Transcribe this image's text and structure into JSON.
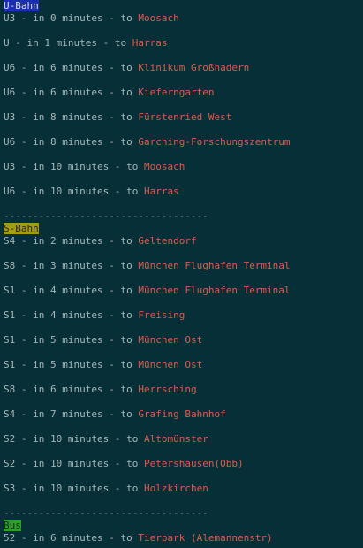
{
  "sections": [
    {
      "header": "U-Bahn",
      "rows": [
        {
          "line": "U3",
          "minutes": "0",
          "dest": "Moosach"
        },
        {
          "line": "U",
          "minutes": "1",
          "dest": "Harras"
        },
        {
          "line": "U6",
          "minutes": "6",
          "dest": "Klinikum Großhadern"
        },
        {
          "line": "U6",
          "minutes": "6",
          "dest": "Kieferngarten"
        },
        {
          "line": "U3",
          "minutes": "8",
          "dest": "Fürstenried West"
        },
        {
          "line": "U6",
          "minutes": "8",
          "dest": "Garching-Forschungszentrum"
        },
        {
          "line": "U3",
          "minutes": "10",
          "dest": "Moosach"
        },
        {
          "line": "U6",
          "minutes": "10",
          "dest": "Harras"
        }
      ]
    },
    {
      "header": "S-Bahn",
      "rows": [
        {
          "line": "S4",
          "minutes": "2",
          "dest": "Geltendorf"
        },
        {
          "line": "S8",
          "minutes": "3",
          "dest": "München Flughafen Terminal"
        },
        {
          "line": "S1",
          "minutes": "4",
          "dest": "München Flughafen Terminal"
        },
        {
          "line": "S1",
          "minutes": "4",
          "dest": "Freising"
        },
        {
          "line": "S1",
          "minutes": "5",
          "dest": "München Ost"
        },
        {
          "line": "S1",
          "minutes": "5",
          "dest": "München Ost"
        },
        {
          "line": "S8",
          "minutes": "6",
          "dest": "Herrsching"
        },
        {
          "line": "S4",
          "minutes": "7",
          "dest": "Grafing Bahnhof"
        },
        {
          "line": "S2",
          "minutes": "10",
          "dest": "Altomünster"
        },
        {
          "line": "S2",
          "minutes": "10",
          "dest": "Petershausen(Obb)"
        },
        {
          "line": "S3",
          "minutes": "10",
          "dest": "Holzkirchen"
        }
      ]
    },
    {
      "header": "Bus",
      "rows": [
        {
          "line": "52",
          "minutes": "6",
          "dest": "Tierpark (Alemannenstr)"
        }
      ]
    }
  ],
  "separator": "-----------------------------------",
  "text": {
    "dash": " - ",
    "in": "in ",
    "minutes_suffix": " minutes",
    "to": "to "
  },
  "colors": {
    "background": "#072f38",
    "text": "#a5b7b8",
    "destination": "#dc5b4b",
    "ubahn_header_bg": "#1b2fb0",
    "sbahn_header_bg": "#a39b12",
    "bus_header_bg": "#2aa12a"
  }
}
